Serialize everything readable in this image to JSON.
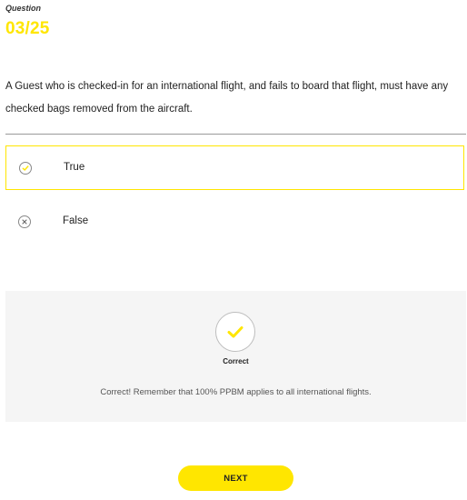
{
  "question": {
    "label": "Question",
    "number": "03/25",
    "text": "A Guest who is checked-in for an international flight, and fails to board that flight, must have any checked bags removed from the aircraft."
  },
  "options": [
    {
      "label": "True",
      "selected": true,
      "icon": "check-icon"
    },
    {
      "label": "False",
      "selected": false,
      "icon": "x-icon"
    }
  ],
  "feedback": {
    "status_icon": "check-icon",
    "title": "Correct",
    "message": "Correct! Remember that 100% PPBM applies to all international flights."
  },
  "next_button": {
    "label": "NEXT"
  },
  "colors": {
    "accent": "#ffe600",
    "divider": "#9a9a9a",
    "feedback_bg": "#f5f5f5"
  }
}
